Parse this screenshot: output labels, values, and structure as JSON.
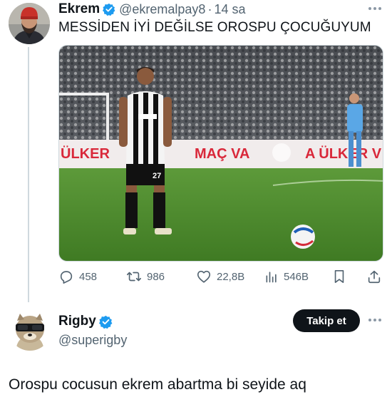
{
  "tweet": {
    "author": {
      "name": "Ekrem",
      "handle": "@ekremalpay8",
      "verified": true,
      "avatar_icon": "avatar-bearded-man-red-beanie"
    },
    "separator": "·",
    "time": "14 sa",
    "text": "MESSİDEN İYİ DEĞİLSE OROSPU ÇOCUĞUYUM",
    "media": {
      "kind": "photo",
      "banner_text": "ÜLKER   MAÇ VA  A ÜLKER V",
      "jersey_sponsor": "Beşiktaş sponsor shirt",
      "jersey_number": "27"
    },
    "stats": {
      "replies": "458",
      "reposts": "986",
      "likes": "22,8B",
      "views": "546B"
    },
    "icons": {
      "reply": "reply-icon",
      "repost": "repost-icon",
      "like": "like-icon",
      "views": "views-icon",
      "bookmark": "bookmark-icon",
      "share": "share-icon",
      "more": "more-icon"
    }
  },
  "follow_card": {
    "name": "Rigby",
    "handle": "@superigby",
    "verified": true,
    "avatar_icon": "avatar-raccoon-sunglasses",
    "follow_label": "Takip et"
  },
  "reply": {
    "text": "Orospu cocusun ekrem abartma bi seyide aq"
  },
  "colors": {
    "verified_blue": "#1d9bf0",
    "secondary_text": "#536471",
    "primary_text": "#0f1419",
    "button_bg": "#0f1419"
  }
}
